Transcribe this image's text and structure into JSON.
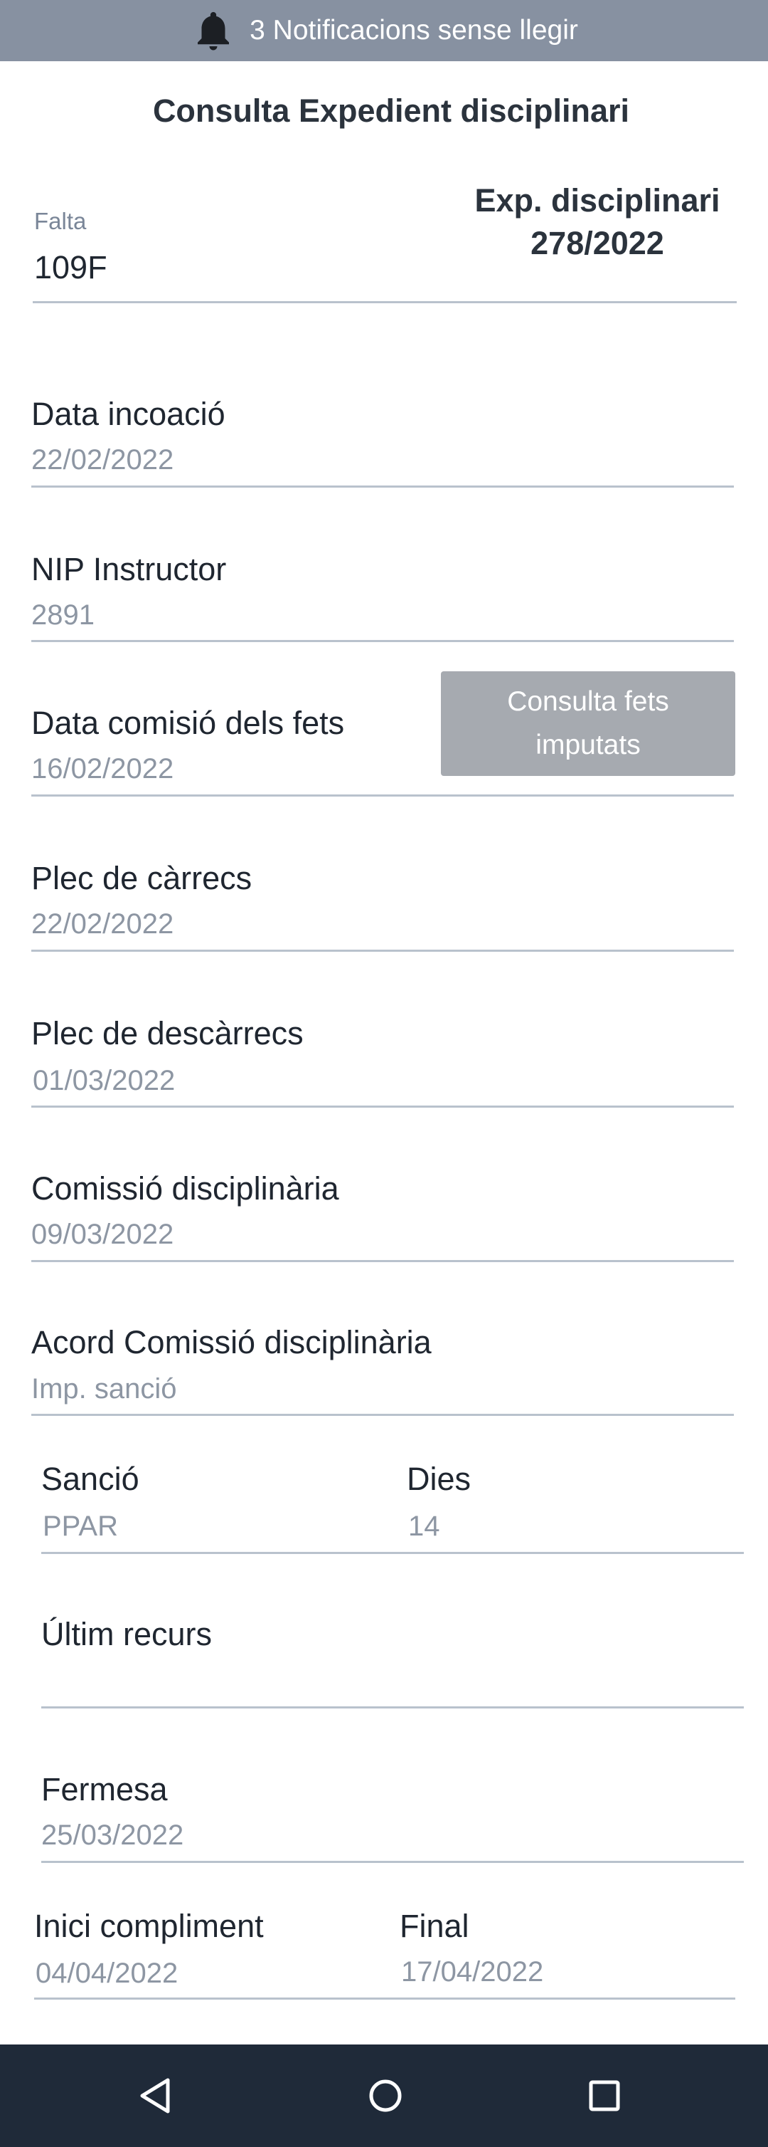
{
  "notification_bar": {
    "text": "3 Notificacions sense llegir",
    "icon": "bell-icon"
  },
  "title": "Consulta Expedient disciplinari",
  "falta": {
    "label": "Falta",
    "value": "109F"
  },
  "expedient": {
    "line1": "Exp. disciplinari",
    "line2": "278/2022"
  },
  "fields": {
    "data_incoacio": {
      "label": "Data incoació",
      "value": "22/02/2022"
    },
    "nip_instructor": {
      "label": "NIP Instructor",
      "value": "2891"
    },
    "data_comisio": {
      "label": "Data comisió dels fets",
      "value": "16/02/2022"
    },
    "plec_carrecs": {
      "label": "Plec de càrrecs",
      "value": "22/02/2022"
    },
    "plec_descarrecs": {
      "label": "Plec de descàrrecs",
      "value": "01/03/2022"
    },
    "comissio": {
      "label": "Comissió disciplinària",
      "value": "09/03/2022"
    },
    "acord": {
      "label": "Acord Comissió disciplinària",
      "value": "Imp. sanció"
    },
    "sancio": {
      "label": "Sanció",
      "value": "PPAR"
    },
    "dies": {
      "label": "Dies",
      "value": "14"
    },
    "ultim_recurs": {
      "label": "Últim recurs",
      "value": ""
    },
    "fermesa": {
      "label": "Fermesa",
      "value": "25/03/2022"
    },
    "inici_compliment": {
      "label": "Inici compliment",
      "value": "04/04/2022"
    },
    "final": {
      "label": "Final",
      "value": "17/04/2022"
    }
  },
  "buttons": {
    "consulta_fets": {
      "line1": "Consulta fets",
      "line2": "imputats"
    }
  },
  "navigation": {
    "back": "back-icon",
    "home": "home-icon",
    "recents": "recents-icon"
  },
  "colors": {
    "notification_bar": "#8791a1",
    "button_disabled": "#a6aab0",
    "nav_bar": "#1f2a39",
    "value_text": "#8d96a3"
  }
}
